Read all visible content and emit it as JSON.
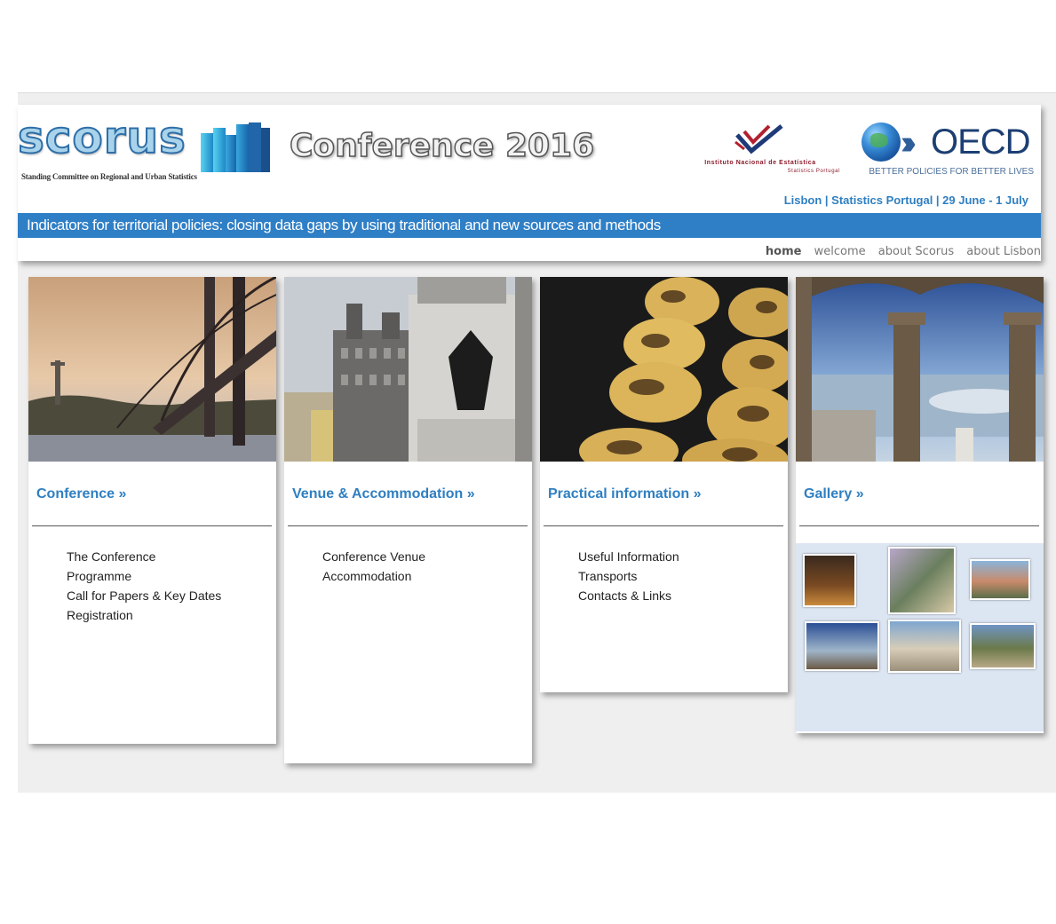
{
  "header": {
    "scorus_word": "scorus",
    "scorus_subtitle": "Standing Committee on Regional and Urban Statistics",
    "conference_title": "Conference 2016",
    "ine_name": "Instituto Nacional de Estatística",
    "ine_subname": "Statistics Portugal",
    "oecd_name": "OECD",
    "oecd_tagline": "BETTER POLICIES FOR BETTER LIVES",
    "location_line": "Lisbon | Statistics Portugal | 29 June - 1 July",
    "banner": "Indicators for territorial policies: closing data gaps by using traditional and new sources and methods"
  },
  "nav": {
    "items": [
      "home",
      "welcome",
      "about Scorus",
      "about Lisbon"
    ]
  },
  "columns": [
    {
      "title": "Conference »",
      "links": [
        "The Conference",
        "Programme",
        "Call for Papers & Key Dates",
        "Registration"
      ]
    },
    {
      "title": "Venue & Accommodation »",
      "links": [
        "Conference Venue",
        "Accommodation"
      ]
    },
    {
      "title": "Practical information »",
      "links": [
        "Useful Information",
        "Transports",
        "Contacts & Links"
      ]
    },
    {
      "title": "Gallery »",
      "links": []
    }
  ],
  "colors": {
    "accent_blue": "#2f7fc1",
    "banner_blue": "#2f7fc6",
    "gallery_bg": "#dce6f2"
  }
}
